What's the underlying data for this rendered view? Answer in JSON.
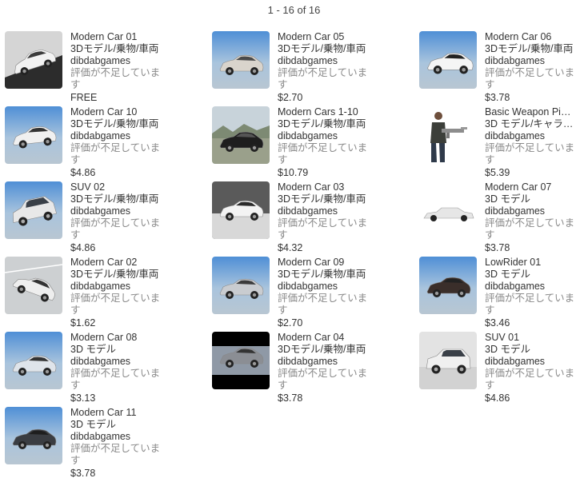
{
  "results": {
    "count_label": "1 - 16 of 16"
  },
  "assets": [
    {
      "name": "Modern Car 01",
      "category": "3Dモデル/乗物/車両",
      "publisher": "dibdabgames",
      "rating": "評価が不足しています",
      "price": "FREE",
      "thumb": "car-tilted-light"
    },
    {
      "name": "Modern Car 05",
      "category": "3Dモデル/乗物/車両",
      "publisher": "dibdabgames",
      "rating": "評価が不足しています",
      "price": "$2.70",
      "thumb": "pickup-sky"
    },
    {
      "name": "Modern Car 06",
      "category": "3Dモデル/乗物/車両",
      "publisher": "dibdabgames",
      "rating": "評価が不足しています",
      "price": "$3.78",
      "thumb": "muscle-car-sky"
    },
    {
      "name": "Modern Car 10",
      "category": "3Dモデル/乗物/車両",
      "publisher": "dibdabgames",
      "rating": "評価が不足しています",
      "price": "$4.86",
      "thumb": "sedan-sky"
    },
    {
      "name": "Modern Cars 1-10",
      "category": "3Dモデル/乗物/車両",
      "publisher": "dibdabgames",
      "rating": "評価が不足しています",
      "price": "$10.79",
      "thumb": "dark-car-landscape"
    },
    {
      "name": "Basic Weapon Pi…",
      "category": "3D モデル/キャラ…",
      "publisher": "dibdabgames",
      "rating": "評価が不足しています",
      "price": "$5.39",
      "thumb": "soldier-with-rifle"
    },
    {
      "name": "SUV 02",
      "category": "3Dモデル/乗物/車両",
      "publisher": "dibdabgames",
      "rating": "評価が不足しています",
      "price": "$4.86",
      "thumb": "suv-tilted-sky"
    },
    {
      "name": "Modern Car 03",
      "category": "3Dモデル/乗物/車両",
      "publisher": "dibdabgames",
      "rating": "評価が不足しています",
      "price": "$4.32",
      "thumb": "coupe-grey-studio"
    },
    {
      "name": "Modern Car 07",
      "category": "3D モデル",
      "publisher": "dibdabgames",
      "rating": "評価が不足しています",
      "price": "$3.78",
      "thumb": "limo-white"
    },
    {
      "name": "Modern Car 02",
      "category": "3Dモデル/乗物/車両",
      "publisher": "dibdabgames",
      "rating": "評価が不足しています",
      "price": "$1.62",
      "thumb": "car-tilted-road"
    },
    {
      "name": "Modern Car 09",
      "category": "3Dモデル/乗物/車両",
      "publisher": "dibdabgames",
      "rating": "評価が不足しています",
      "price": "$2.70",
      "thumb": "sedan-silver-sky"
    },
    {
      "name": "LowRider 01",
      "category": "3D モデル",
      "publisher": "dibdabgames",
      "rating": "評価が不足しています",
      "price": "$3.46",
      "thumb": "lowrider-sky"
    },
    {
      "name": "Modern Car 08",
      "category": "3D モデル",
      "publisher": "dibdabgames",
      "rating": "評価が不足しています",
      "price": "$3.13",
      "thumb": "coupe-blue-sky"
    },
    {
      "name": "Modern Car 04",
      "category": "3Dモデル/乗物/車両",
      "publisher": "dibdabgames",
      "rating": "評価が不足しています",
      "price": "$3.78",
      "thumb": "car-letterbox"
    },
    {
      "name": "SUV 01",
      "category": "3D モデル",
      "publisher": "dibdabgames",
      "rating": "評価が不足しています",
      "price": "$4.86",
      "thumb": "suv-white-studio"
    },
    {
      "name": "Modern Car 11",
      "category": "3D モデル",
      "publisher": "dibdabgames",
      "rating": "評価が不足しています",
      "price": "$3.78",
      "thumb": "dark-sedan-sky"
    }
  ]
}
